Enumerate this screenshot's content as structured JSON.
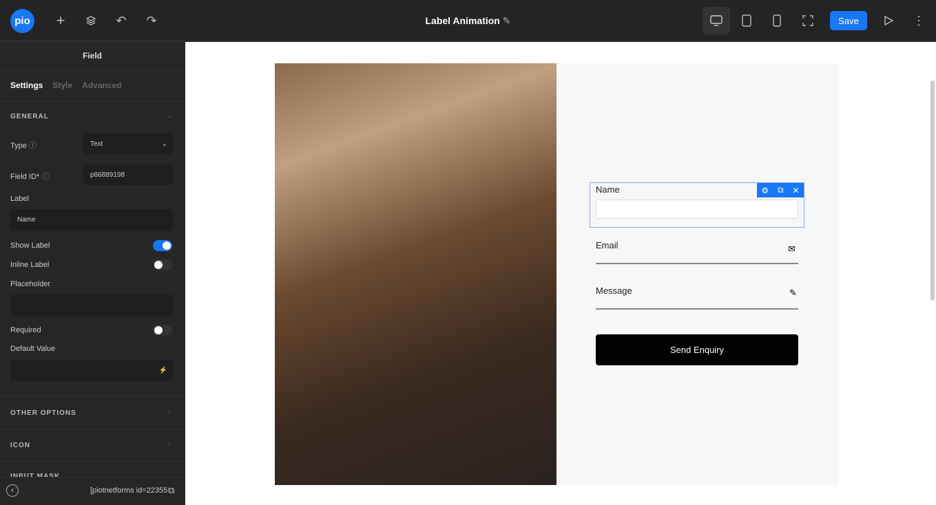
{
  "topbar": {
    "logo": "pio",
    "title": "Label Animation",
    "save_label": "Save",
    "icons": [
      "plus-icon",
      "layers-icon",
      "undo-icon",
      "redo-icon",
      "edit-icon",
      "desktop-icon",
      "tablet-icon",
      "mobile-icon",
      "fullscreen-icon",
      "preview-icon",
      "more-icon"
    ]
  },
  "sidebar": {
    "title": "Field",
    "tabs": [
      "Settings",
      "Style",
      "Advanced"
    ],
    "general": "GENERAL",
    "type_label": "Type",
    "type_value": "Text",
    "field_id_label": "Field ID*",
    "field_id_value": "p86889198",
    "label_label": "Label",
    "label_value": "Name",
    "show_label": "Show Label",
    "show_label_on": true,
    "inline_label": "Inline Label",
    "inline_label_on": false,
    "placeholder_label": "Placeholder",
    "placeholder_value": "",
    "required_label": "Required",
    "required_on": false,
    "default_value_label": "Default Value",
    "default_value": "",
    "other_options": "OTHER OPTIONS",
    "icon": "ICON",
    "input_mask": "INPUT MASK",
    "shortcode": "[piotnetforms id=22355"
  },
  "form": {
    "name_label": "Name",
    "email_label": "Email",
    "message_label": "Message",
    "submit_label": "Send Enquiry"
  },
  "colors": {
    "accent": "#1877f2"
  }
}
